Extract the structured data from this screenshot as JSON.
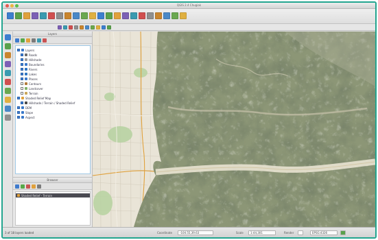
{
  "window": {
    "title": "QGIS 2.4 Chugiak",
    "accent_color": "#22a58f"
  },
  "toolbar": {
    "main_icons": [
      "new-project-icon",
      "open-project-icon",
      "save-project-icon",
      "save-as-icon",
      "print-composer-icon",
      "pan-icon",
      "pan-to-selection-icon",
      "zoom-in-icon",
      "zoom-out-icon",
      "zoom-full-icon",
      "zoom-layer-icon",
      "zoom-last-icon",
      "refresh-icon",
      "identify-icon",
      "select-icon",
      "deselect-icon",
      "measure-icon",
      "map-tips-icon",
      "bookmark-icon",
      "annotation-icon",
      "label-icon",
      "help-icon"
    ],
    "secondary_icons": [
      "edit-icon",
      "save-edits-icon",
      "add-feature-icon",
      "move-feature-icon",
      "delete-icon",
      "cut-icon",
      "copy-icon",
      "paste-icon",
      "undo-icon",
      "redo-icon"
    ]
  },
  "layers_panel": {
    "title": "Layers",
    "items": [
      {
        "label": "Layers",
        "checked": true,
        "indent": 0,
        "color": "#3a78c9"
      },
      {
        "label": "Roads",
        "checked": true,
        "indent": 1,
        "color": "#6b6b6b"
      },
      {
        "label": "Hillshade",
        "checked": true,
        "indent": 1,
        "color": "#9a9a9a"
      },
      {
        "label": "Boundaries",
        "checked": true,
        "indent": 1,
        "color": "#3a78c9"
      },
      {
        "label": "Rivers",
        "checked": true,
        "indent": 1,
        "color": "#2e74c0"
      },
      {
        "label": "Lakes",
        "checked": true,
        "indent": 1,
        "color": "#2e74c0"
      },
      {
        "label": "Places",
        "checked": true,
        "indent": 1,
        "color": "#3a78c9"
      },
      {
        "label": "Contours",
        "checked": false,
        "indent": 1,
        "color": "#b07a3a"
      },
      {
        "label": "Landcover",
        "checked": false,
        "indent": 1,
        "color": "#7fb06a"
      },
      {
        "label": "Terrain",
        "checked": false,
        "indent": 1,
        "color": "#c9a65a"
      },
      {
        "label": "Shaded Relief Map",
        "checked": true,
        "indent": 0,
        "color": "#e0a13c"
      },
      {
        "label": "Hillshade / Terrain / Shaded Relief",
        "checked": true,
        "indent": 1,
        "color": "#4a4a4a"
      },
      {
        "label": "DEM",
        "checked": true,
        "indent": 0,
        "color": "#3a78c9"
      },
      {
        "label": "Slope",
        "checked": true,
        "indent": 0,
        "color": "#3a78c9"
      },
      {
        "label": "Aspect",
        "checked": true,
        "indent": 0,
        "color": "#3a78c9"
      }
    ]
  },
  "browser_panel": {
    "title": "Browser",
    "selected_item": "Shaded Relief - Terrain"
  },
  "statusbar": {
    "message": "3 of 18 layers loaded",
    "coordinate_label": "Coordinate",
    "coordinate": "-104.55,39.63",
    "scale_label": "Scale",
    "scale": "1:44,301",
    "render_label": "Render",
    "crs": "EPSG:4326"
  }
}
